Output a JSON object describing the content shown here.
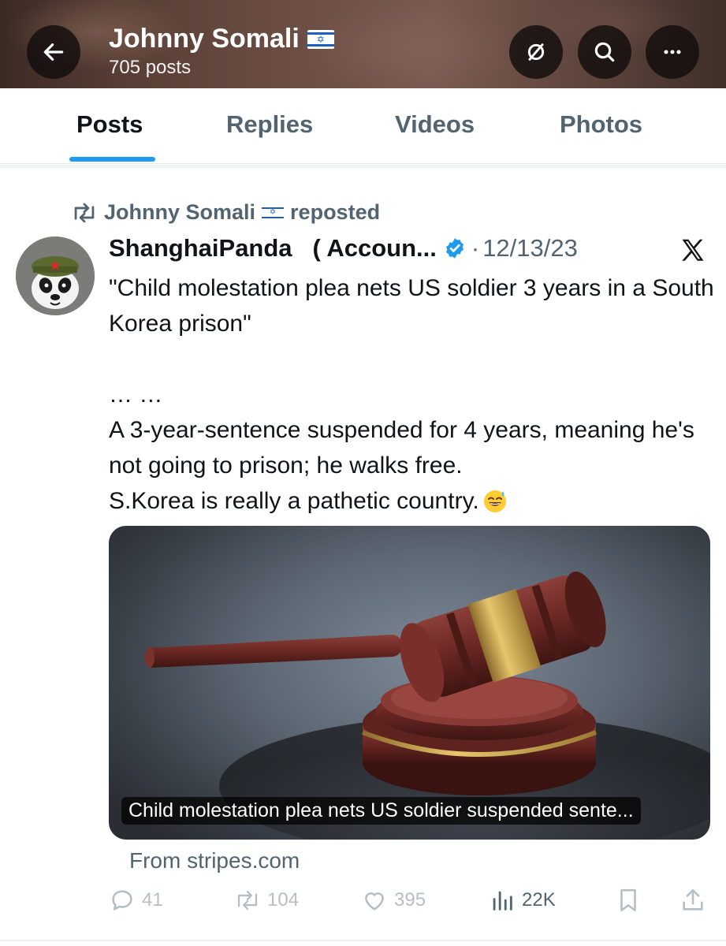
{
  "header": {
    "name": "Johnny Somali",
    "posts_count": "705 posts",
    "back_icon": "arrow-left-icon",
    "actions": [
      "hide-icon",
      "search-icon",
      "more-icon"
    ]
  },
  "tabs": [
    {
      "label": "Posts",
      "active": true
    },
    {
      "label": "Replies",
      "active": false
    },
    {
      "label": "Videos",
      "active": false
    },
    {
      "label": "Photos",
      "active": false
    }
  ],
  "repost": {
    "user": "Johnny Somali",
    "suffix": "reposted"
  },
  "tweet": {
    "author_name": "ShanghaiPanda",
    "author_name_extra": "( Accoun...",
    "separator": "·",
    "date": "12/13/23",
    "text": "\"Child molestation plea nets US soldier 3 years in a South Korea prison\"\n\n… …\nA 3-year-sentence suspended for 4 years, meaning he's not going to prison; he walks free.\nS.Korea is really a pathetic country.",
    "emoji": "sweat-smile-emoji",
    "card": {
      "caption": "Child molestation plea nets US soldier suspended sente...",
      "source": "From stripes.com"
    },
    "stats": {
      "replies": "41",
      "reposts": "104",
      "likes": "395",
      "views": "22K"
    }
  },
  "colors": {
    "accent": "#1d9bf0",
    "muted": "#536471",
    "verified": "#1d9bf0"
  }
}
